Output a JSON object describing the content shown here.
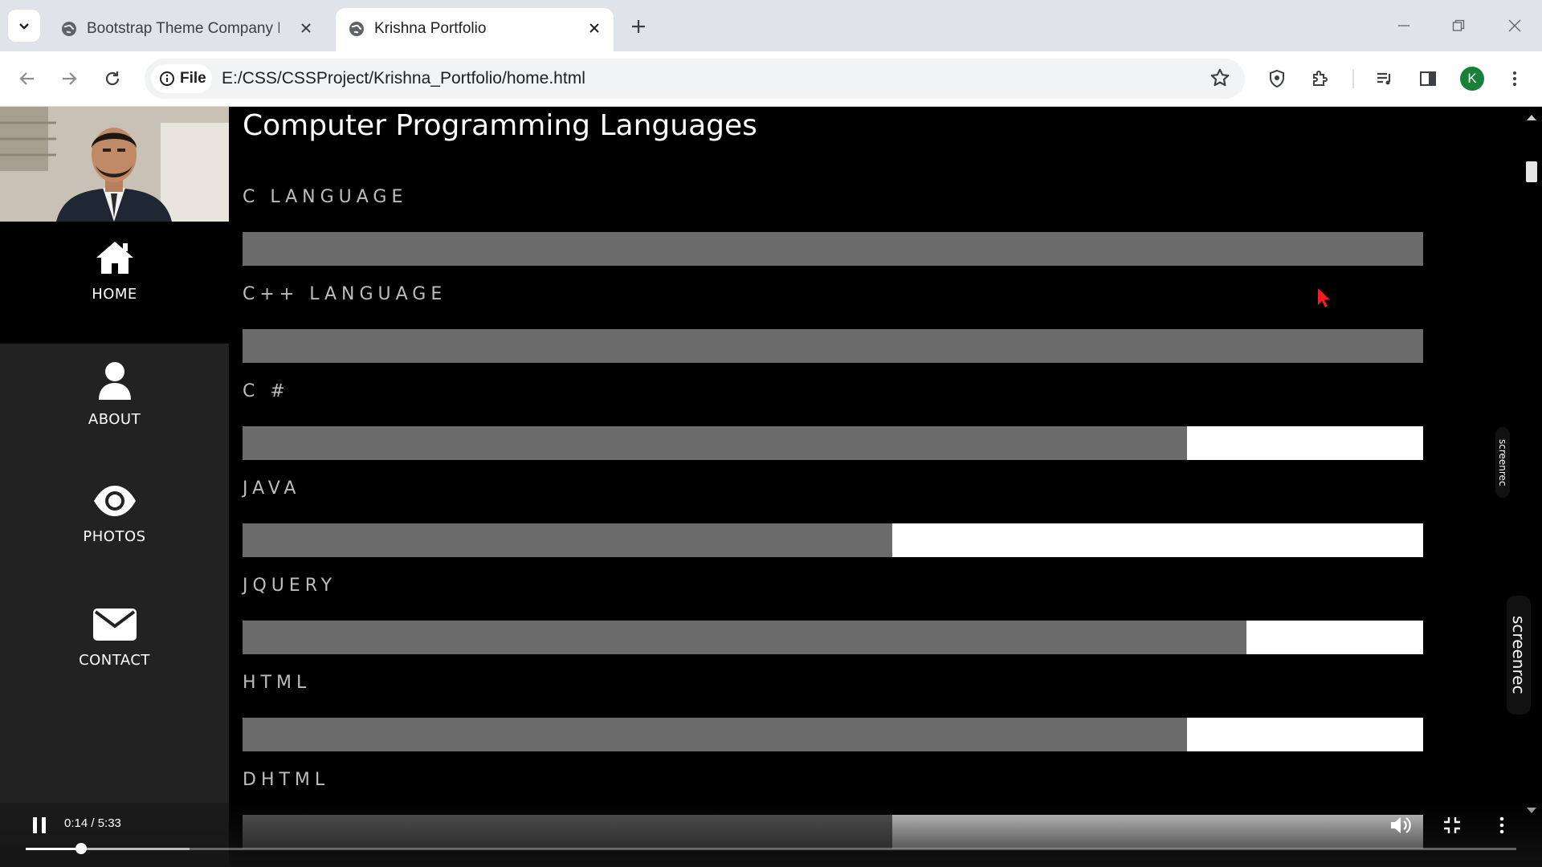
{
  "browser": {
    "tabs": [
      {
        "title": "Bootstrap Theme Company Pag",
        "active": false
      },
      {
        "title": "Krishna Portfolio",
        "active": true
      }
    ],
    "address": {
      "chip": "File",
      "url": "E:/CSS/CSSProject/Krishna_Portfolio/home.html"
    },
    "profile_initial": "K"
  },
  "sidebar": {
    "items": [
      {
        "label": "HOME",
        "icon": "home-icon",
        "active": true
      },
      {
        "label": "ABOUT",
        "icon": "user-icon",
        "active": false
      },
      {
        "label": "PHOTOS",
        "icon": "eye-icon",
        "active": false
      },
      {
        "label": "CONTACT",
        "icon": "envelope-icon",
        "active": false
      }
    ]
  },
  "main": {
    "heading": "Computer Programming Languages",
    "skills": [
      {
        "label": "C LANGUAGE",
        "level": 100
      },
      {
        "label": "C++ LANGUAGE",
        "level": 100
      },
      {
        "label": "C #",
        "level": 80
      },
      {
        "label": "JAVA",
        "level": 55
      },
      {
        "label": "JQUERY",
        "level": 85
      },
      {
        "label": "HTML",
        "level": 80
      },
      {
        "label": "DHTML",
        "level": 55
      }
    ]
  },
  "overlays": {
    "screenrec_small": "screenrec",
    "screenrec_big": "screenrec"
  },
  "player": {
    "time": "0:14 / 5:33",
    "played_percent": 3.7,
    "buffered_percent": 11
  }
}
